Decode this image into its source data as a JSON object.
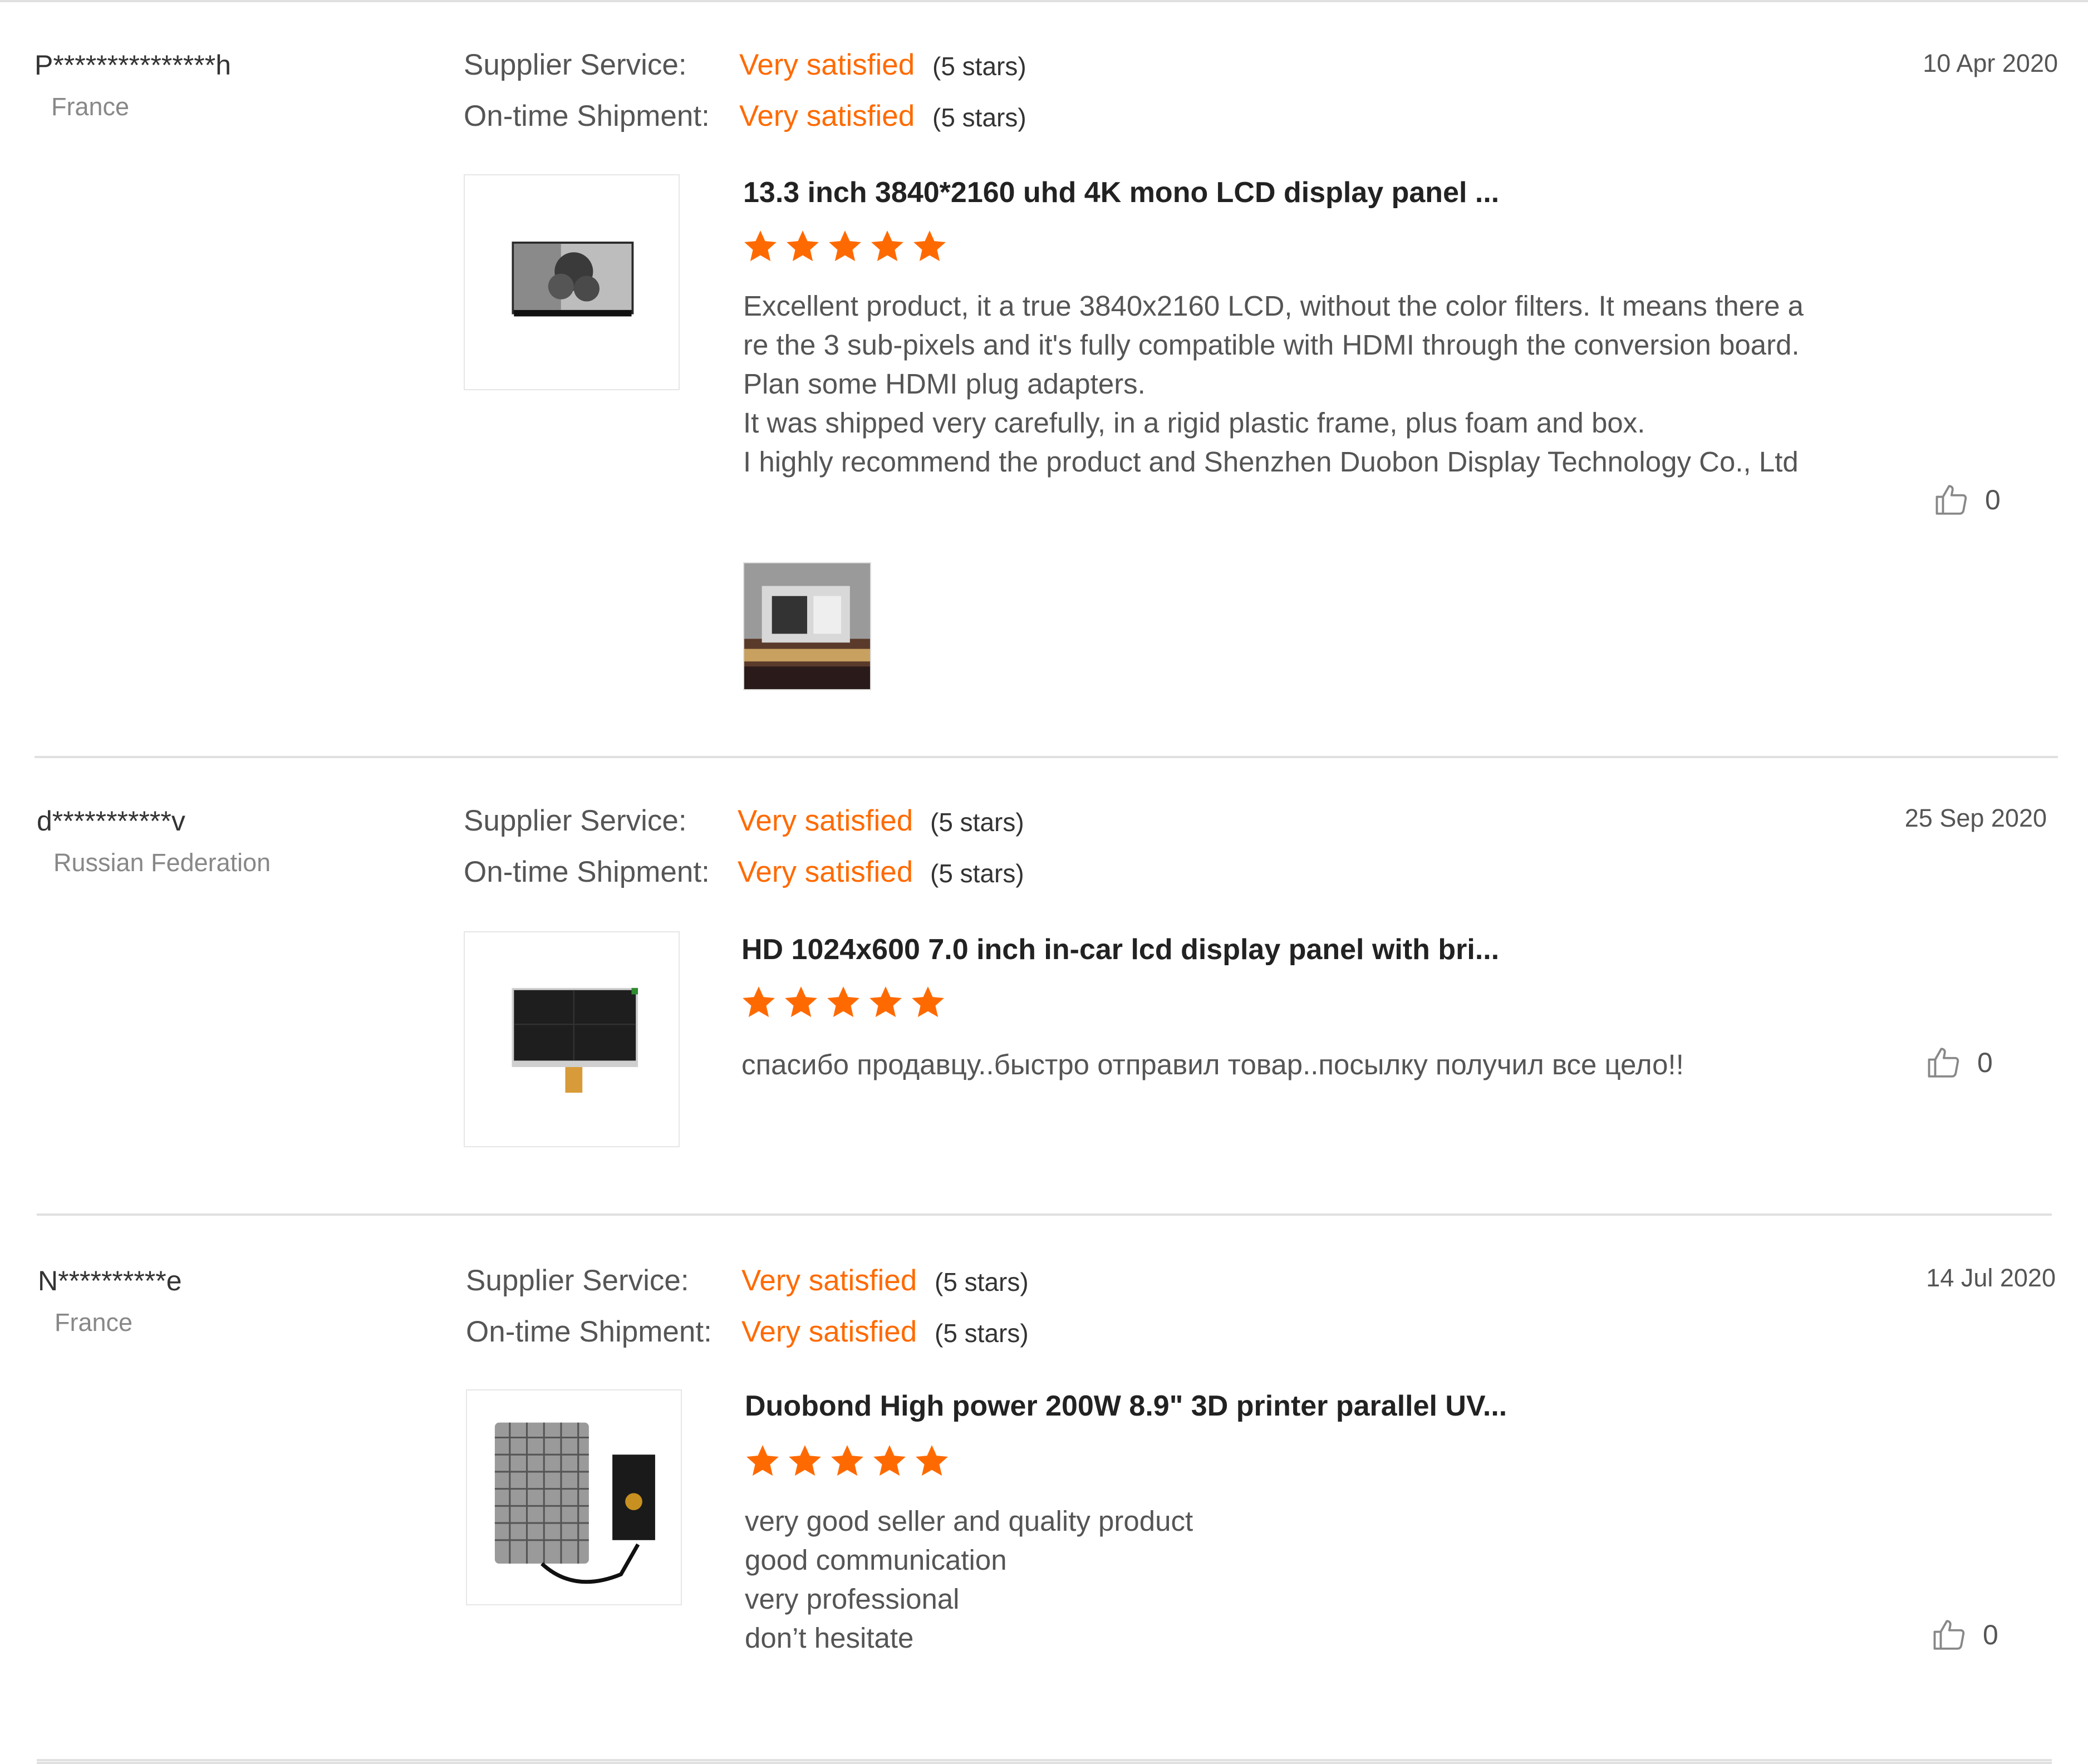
{
  "accent_color": "#ff6a00",
  "labels": {
    "supplier_service": "Supplier Service:",
    "ontime_shipment": "On-time Shipment:"
  },
  "reviews": [
    {
      "user": "P***************h",
      "country": "France",
      "date": "10 Apr 2020",
      "supplier_service": {
        "rating": "Very satisfied",
        "stars": "(5 stars)"
      },
      "ontime_shipment": {
        "rating": "Very satisfied",
        "stars": "(5 stars)"
      },
      "product_title": "13.3 inch 3840*2160 uhd 4K mono LCD display panel ...",
      "product_stars": 5,
      "product_image_icon": "mono-lcd-panel-image",
      "comment": "Excellent product, it a true 3840x2160 LCD, without the color filters. It means there are the 3 sub-pixels and it's fully compatible with HDMI through the conversion board. Plan some HDMI plug adapters.\nIt was shipped very carefully, in a rigid plastic frame, plus foam and box.\nI highly recommend the product and Shenzhen Duobon Display Technology Co., Ltd",
      "has_photo": true,
      "likes": "0"
    },
    {
      "user": "d***********v",
      "country": "Russian Federation",
      "date": "25 Sep 2020",
      "supplier_service": {
        "rating": "Very satisfied",
        "stars": "(5 stars)"
      },
      "ontime_shipment": {
        "rating": "Very satisfied",
        "stars": "(5 stars)"
      },
      "product_title": "HD 1024x600 7.0 inch in-car lcd display panel with bri...",
      "product_stars": 5,
      "product_image_icon": "in-car-lcd-panel-image",
      "comment": "спасибо продавцу..быстро отправил товар..посылку получил все цело!!",
      "has_photo": false,
      "likes": "0"
    },
    {
      "user": "N**********e",
      "country": "France",
      "date": "14 Jul 2020",
      "supplier_service": {
        "rating": "Very satisfied",
        "stars": "(5 stars)"
      },
      "ontime_shipment": {
        "rating": "Very satisfied",
        "stars": "(5 stars)"
      },
      "product_title": "Duobond High power 200W 8.9\" 3D printer parallel UV...",
      "product_stars": 5,
      "product_image_icon": "uv-light-source-image",
      "comment": "very good seller and quality product\ngood communication\nvery professional\ndon’t hesitate",
      "has_photo": false,
      "likes": "0"
    }
  ]
}
